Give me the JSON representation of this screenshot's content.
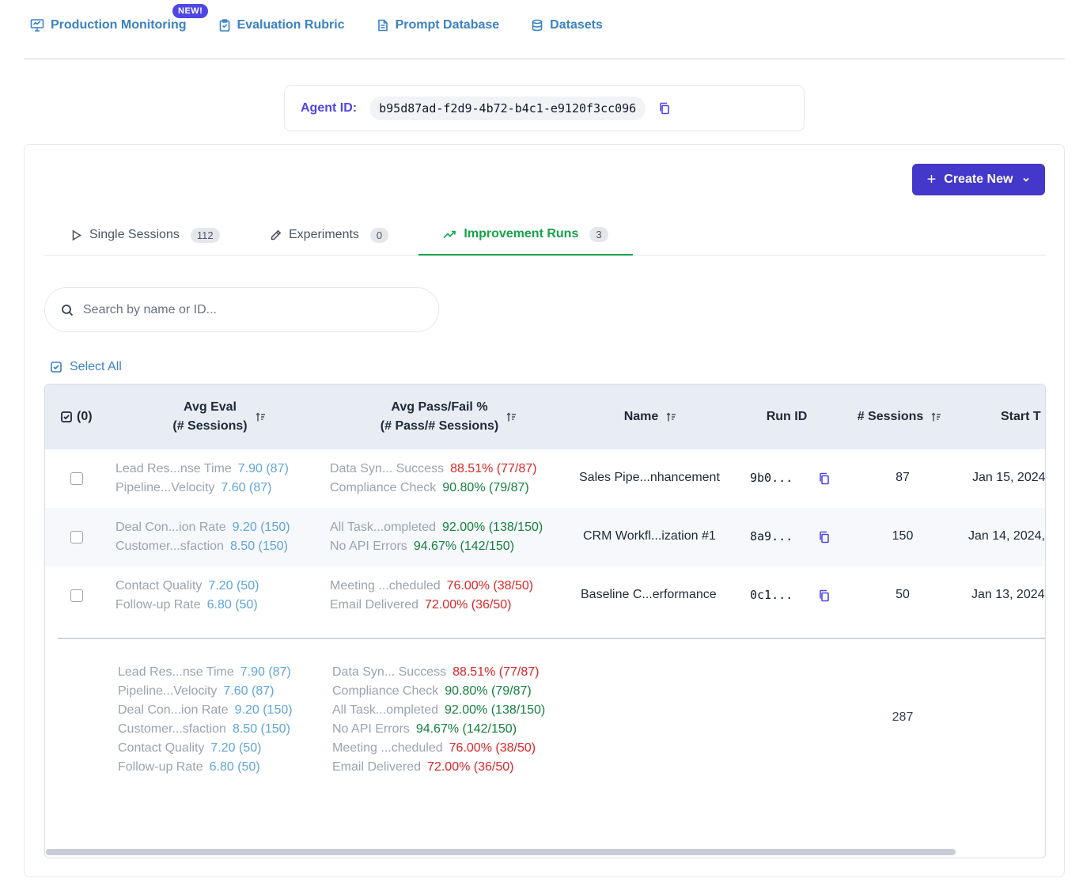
{
  "nav": {
    "items": [
      {
        "label": "Production Monitoring",
        "icon": "monitor-icon"
      },
      {
        "label": "Evaluation Rubric",
        "icon": "clipboard-icon"
      },
      {
        "label": "Prompt Database",
        "icon": "document-icon"
      },
      {
        "label": "Datasets",
        "icon": "database-icon"
      }
    ],
    "new_badge": "NEW!"
  },
  "agent": {
    "label": "Agent ID:",
    "id": "b95d87ad-f2d9-4b72-b4c1-e9120f3cc096"
  },
  "toolbar": {
    "create_label": "Create New"
  },
  "tabs": [
    {
      "label": "Single Sessions",
      "count": "112"
    },
    {
      "label": "Experiments",
      "count": "0"
    },
    {
      "label": "Improvement Runs",
      "count": "3"
    }
  ],
  "search": {
    "placeholder": "Search by name or ID..."
  },
  "select_all": "Select All",
  "table": {
    "headers": {
      "check": "(0)",
      "avg_eval_1": "Avg Eval",
      "avg_eval_2": "(# Sessions)",
      "pass_fail_1": "Avg Pass/Fail %",
      "pass_fail_2": "(# Pass/# Sessions)",
      "name": "Name",
      "run_id": "Run ID",
      "sessions": "# Sessions",
      "start": "Start T"
    },
    "rows": [
      {
        "evals": [
          {
            "label": "Lead Res...nse Time",
            "value": "7.90 (87)"
          },
          {
            "label": "Pipeline...Velocity",
            "value": "7.60 (87)"
          }
        ],
        "passfail": [
          {
            "label": "Data Syn... Success",
            "value": "88.51% (77/87)",
            "status": "red"
          },
          {
            "label": "Compliance Check",
            "value": "90.80% (79/87)",
            "status": "green"
          }
        ],
        "name": "Sales Pipe...nhancement",
        "run_id": "9b0...",
        "sessions": "87",
        "start": "Jan 15, 2024"
      },
      {
        "evals": [
          {
            "label": "Deal Con...ion Rate",
            "value": "9.20 (150)"
          },
          {
            "label": "Customer...sfaction",
            "value": "8.50 (150)"
          }
        ],
        "passfail": [
          {
            "label": "All Task...ompleted",
            "value": "92.00% (138/150)",
            "status": "green"
          },
          {
            "label": "No API Errors",
            "value": "94.67% (142/150)",
            "status": "green"
          }
        ],
        "name": "CRM Workfl...ization #1",
        "run_id": "8a9...",
        "sessions": "150",
        "start": "Jan 14, 2024,"
      },
      {
        "evals": [
          {
            "label": "Contact Quality",
            "value": "7.20 (50)"
          },
          {
            "label": "Follow-up Rate",
            "value": "6.80 (50)"
          }
        ],
        "passfail": [
          {
            "label": "Meeting ...cheduled",
            "value": "76.00% (38/50)",
            "status": "red"
          },
          {
            "label": "Email Delivered",
            "value": "72.00% (36/50)",
            "status": "red"
          }
        ],
        "name": "Baseline C...erformance",
        "run_id": "0c1...",
        "sessions": "50",
        "start": "Jan 13, 2024"
      }
    ],
    "summary": {
      "evals": [
        {
          "label": "Lead Res...nse Time",
          "value": "7.90 (87)"
        },
        {
          "label": "Pipeline...Velocity",
          "value": "7.60 (87)"
        },
        {
          "label": "Deal Con...ion Rate",
          "value": "9.20 (150)"
        },
        {
          "label": "Customer...sfaction",
          "value": "8.50 (150)"
        },
        {
          "label": "Contact Quality",
          "value": "7.20 (50)"
        },
        {
          "label": "Follow-up Rate",
          "value": "6.80 (50)"
        }
      ],
      "passfail": [
        {
          "label": "Data Syn... Success",
          "value": "88.51% (77/87)",
          "status": "red"
        },
        {
          "label": "Compliance Check",
          "value": "90.80% (79/87)",
          "status": "green"
        },
        {
          "label": "All Task...ompleted",
          "value": "92.00% (138/150)",
          "status": "green"
        },
        {
          "label": "No API Errors",
          "value": "94.67% (142/150)",
          "status": "green"
        },
        {
          "label": "Meeting ...cheduled",
          "value": "76.00% (38/50)",
          "status": "red"
        },
        {
          "label": "Email Delivered",
          "value": "72.00% (36/50)",
          "status": "red"
        }
      ],
      "sessions_total": "287"
    }
  },
  "colors": {
    "accent": "#4338ca",
    "link": "#3b82c4",
    "active_tab": "#16a34a",
    "eval_value": "#60a5d8",
    "pass": "#15803d",
    "fail": "#dc2626"
  }
}
